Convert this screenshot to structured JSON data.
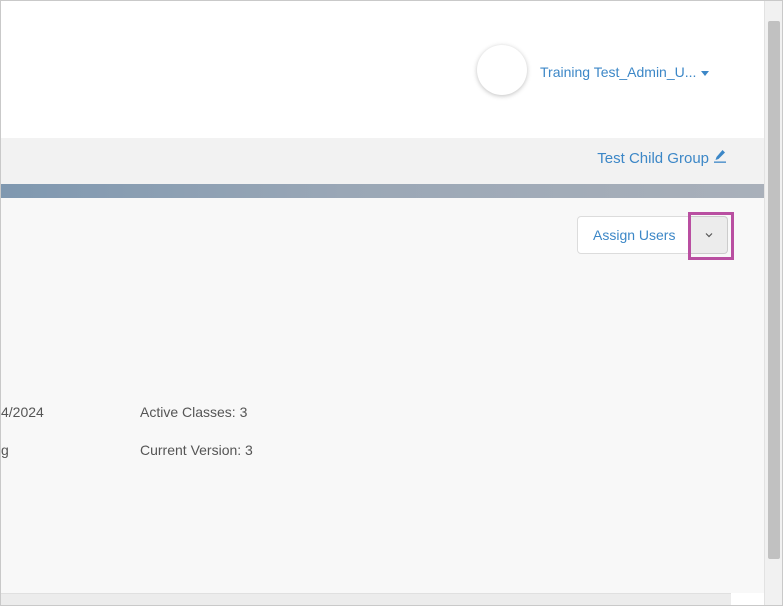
{
  "header": {
    "user_name": "Training Test_Admin_U..."
  },
  "group_bar": {
    "group_name": "Test Child Group"
  },
  "toolbar": {
    "assign_users_label": "Assign Users"
  },
  "details": {
    "date_fragment": "4/2024",
    "status_fragment": "g",
    "active_classes": "Active Classes: 3",
    "current_version": "Current Version: 3"
  },
  "colors": {
    "link_blue": "#3c87c7",
    "highlight_magenta": "#b94fa1",
    "band_start": "#7f98b0",
    "band_end": "#a9b0ba"
  },
  "icons": {
    "user_menu_caret": "caret-down-icon",
    "edit": "pencil-icon",
    "dropdown": "chevron-down-icon"
  }
}
